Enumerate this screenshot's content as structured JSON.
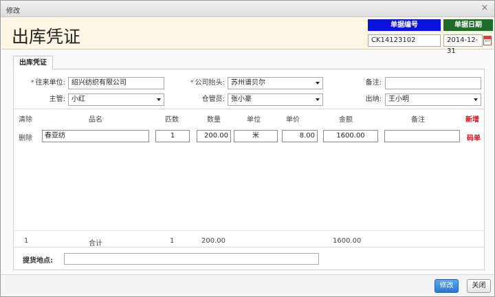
{
  "window": {
    "title": "修改",
    "close_icon": "×"
  },
  "header": {
    "title": "出库凭证",
    "doc_no_label": "单据编号",
    "doc_no_value": "CK14123102",
    "doc_date_label": "单据日期",
    "doc_date_value": "2014-12-31",
    "colors": {
      "doc_no_bg": "#0a12e0",
      "doc_date_bg": "#1e6b2a",
      "band_bg": "#fdf6e2"
    }
  },
  "tab": {
    "label": "出库凭证"
  },
  "form": {
    "required_mark": "*",
    "partner_label": "往来单位:",
    "partner_value": "绍兴纺织有限公司",
    "company_label": "公司抬头:",
    "company_value": "苏州谱贝尔",
    "remark_label": "备注:",
    "remark_value": "",
    "supervisor_label": "主管:",
    "supervisor_value": "小红",
    "keeper_label": "仓管员:",
    "keeper_value": "张小豪",
    "cashier_label": "出纳:",
    "cashier_value": "王小明"
  },
  "grid": {
    "headers": {
      "clear": "清除",
      "name": "品名",
      "pieces": "匹数",
      "qty": "数量",
      "unit": "单位",
      "price": "单价",
      "amount": "金额",
      "remark": "备注",
      "add": "新增"
    },
    "rows": [
      {
        "delete": "删除",
        "name": "春亚纺",
        "pieces": "1",
        "qty": "200.00",
        "unit": "米",
        "price": "8.00",
        "amount": "1600.00",
        "remark": "",
        "code": "码单"
      }
    ],
    "footer": {
      "count": "1",
      "total_label": "合计",
      "pieces_total": "1",
      "qty_total": "200.00",
      "amount_total": "1600.00"
    }
  },
  "pickup": {
    "label": "提货地点:",
    "value": ""
  },
  "buttons": {
    "save": "修改",
    "close": "关闭"
  }
}
